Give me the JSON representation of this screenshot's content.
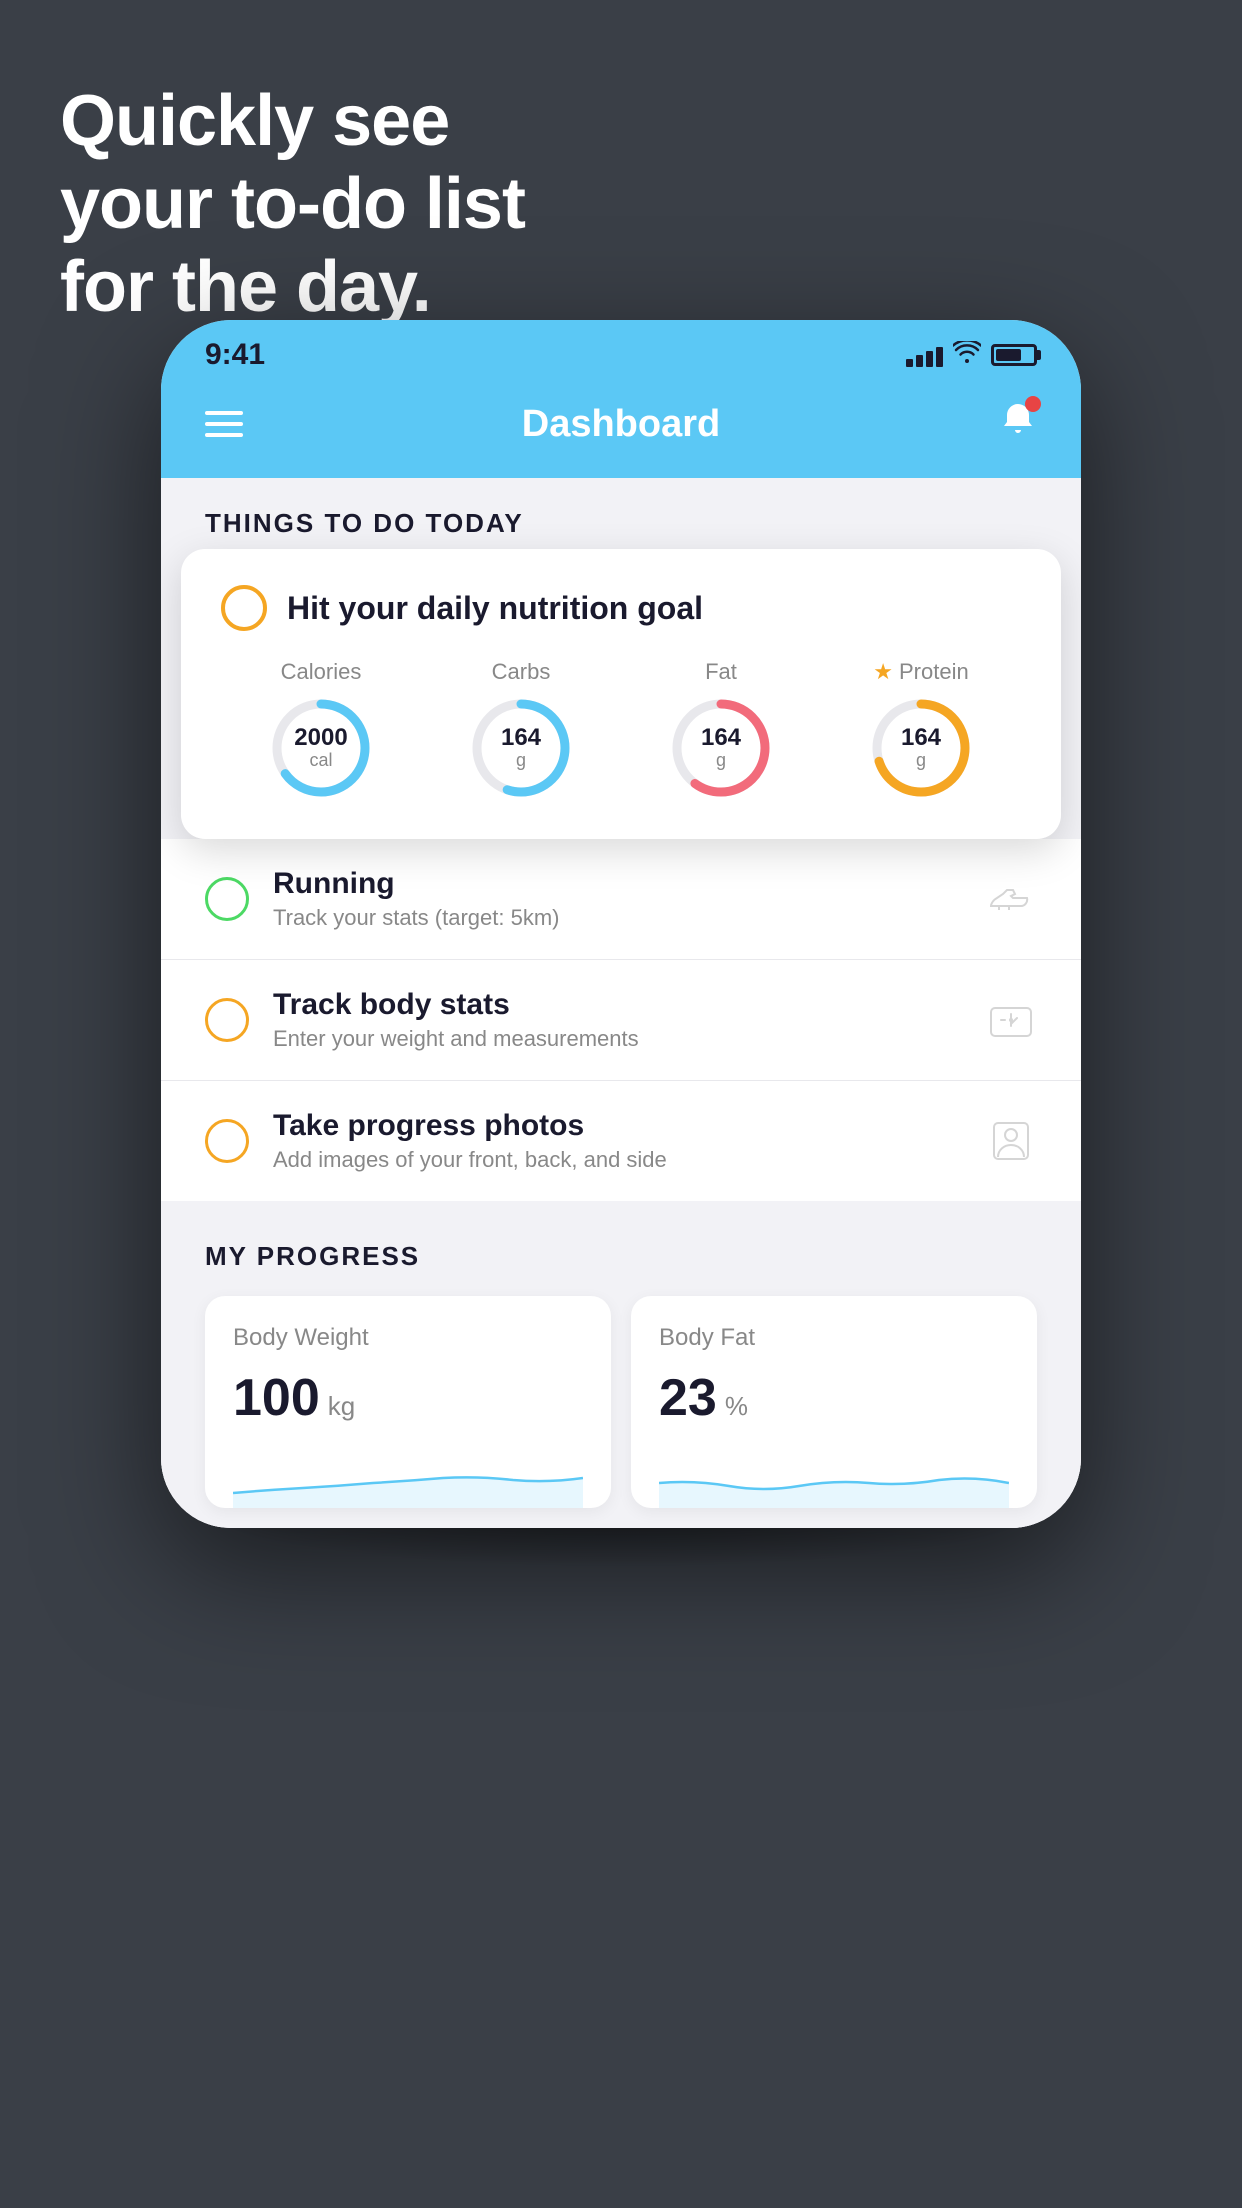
{
  "hero": {
    "line1": "Quickly see",
    "line2": "your to-do list",
    "line3": "for the day."
  },
  "status_bar": {
    "time": "9:41",
    "signal_bars": [
      8,
      12,
      16,
      20
    ],
    "wifi": "wifi",
    "battery": "battery"
  },
  "app_header": {
    "title": "Dashboard",
    "menu_icon": "hamburger",
    "bell_icon": "bell"
  },
  "things_section": {
    "title": "THINGS TO DO TODAY"
  },
  "nutrition_card": {
    "title": "Hit your daily nutrition goal",
    "macros": [
      {
        "label": "Calories",
        "value": "2000",
        "unit": "cal",
        "color": "#5bc8f5",
        "percent": 65
      },
      {
        "label": "Carbs",
        "value": "164",
        "unit": "g",
        "color": "#5bc8f5",
        "percent": 55
      },
      {
        "label": "Fat",
        "value": "164",
        "unit": "g",
        "color": "#f26b7b",
        "percent": 60
      },
      {
        "label": "Protein",
        "value": "164",
        "unit": "g",
        "color": "#f5a623",
        "percent": 70,
        "starred": true
      }
    ]
  },
  "todo_items": [
    {
      "name": "Running",
      "desc": "Track your stats (target: 5km)",
      "circle_color": "green",
      "icon": "shoe"
    },
    {
      "name": "Track body stats",
      "desc": "Enter your weight and measurements",
      "circle_color": "yellow",
      "icon": "scale"
    },
    {
      "name": "Take progress photos",
      "desc": "Add images of your front, back, and side",
      "circle_color": "yellow",
      "icon": "person"
    }
  ],
  "progress_section": {
    "title": "MY PROGRESS",
    "cards": [
      {
        "name": "Body Weight",
        "value": "100",
        "unit": "kg",
        "sparkline_color": "#5bc8f5"
      },
      {
        "name": "Body Fat",
        "value": "23",
        "unit": "%",
        "sparkline_color": "#5bc8f5"
      }
    ]
  }
}
